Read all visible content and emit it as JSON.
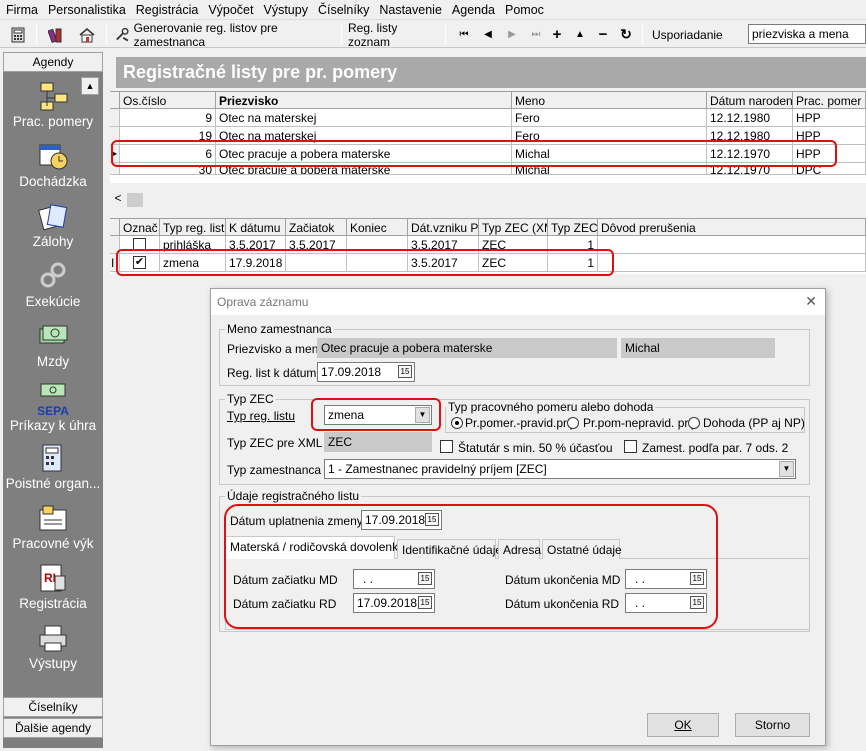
{
  "menu": [
    "Firma",
    "Personalistika",
    "Registrácia",
    "Výpočet",
    "Výstupy",
    "Číselníky",
    "Nastavenie",
    "Agenda",
    "Pomoc"
  ],
  "toolbar": {
    "gen_label": "Generovanie reg. listov pre  zamestnanca",
    "reg_list_label": "Reg. listy zoznam",
    "sort_label": "Usporiadanie",
    "sort_value": "priezviska a mena"
  },
  "sidebar": {
    "head": "Agendy",
    "items": [
      "Prac. pomery",
      "Dochádzka",
      "Zálohy",
      "Exekúcie",
      "Mzdy",
      "Príkazy k úhra",
      "Poistné organ...",
      "Pracovné výk",
      "Registrácia",
      "Výstupy"
    ],
    "sepa": "SEPA",
    "footer1": "Číselníky",
    "footer2": "Ďalšie agendy"
  },
  "main_title": "Registračné listy pre pr. pomery",
  "top_grid": {
    "headers": [
      "Os.číslo",
      "Priezvisko",
      "Meno",
      "Dátum narodenia",
      "Prac. pomer"
    ],
    "rows": [
      [
        "9",
        "Otec na materskej",
        "Fero",
        "12.12.1980",
        "HPP"
      ],
      [
        "19",
        "Otec na materskej",
        "Fero",
        "12.12.1980",
        "HPP"
      ],
      [
        "6",
        "Otec pracuje a pobera materske",
        "Michal",
        "12.12.1970",
        "HPP"
      ],
      [
        "30",
        "Otec pracuje a pobera materske",
        "Michal",
        "12.12.1970",
        "DPC"
      ]
    ]
  },
  "scroll_left": "<",
  "bottom_grid": {
    "headers": [
      "Označ",
      "Typ reg. listu",
      "K dátumu",
      "Začiatok",
      "Koniec",
      "Dát.vzniku PV",
      "Typ ZEC (XM",
      "Typ ZEC (",
      "Dôvod prerušenia"
    ],
    "rows": [
      [
        "",
        "prihláška",
        "3.5.2017",
        "3.5.2017",
        "",
        "3.5.2017",
        "ZEC",
        "1",
        ""
      ],
      [
        "",
        "zmena",
        "17.9.2018",
        "",
        "",
        "3.5.2017",
        "ZEC",
        "1",
        ""
      ]
    ],
    "marker": "I"
  },
  "dialog": {
    "title": "Oprava záznamu",
    "close": "✕",
    "g1_title": "Meno zamestnanca",
    "name_label": "Priezvisko a meno",
    "surname": "Otec pracuje a pobera materske",
    "firstname": "Michal",
    "reglist_label": "Reg. list k dátumu",
    "reglist_date": "17.09.2018",
    "g2_title": "Typ ZEC",
    "typ_reg_label": "Typ reg. listu",
    "typ_reg_value": "zmena",
    "pp_group_title": "Typ pracovného pomeru alebo dohoda",
    "radio1": "Pr.pomer.-pravid.príj.",
    "radio2": "Pr.pom-nepravid. príj.",
    "radio3": "Dohoda (PP aj NP)",
    "zec_xml_label": "Typ ZEC pre XML",
    "zec_xml_value": "ZEC",
    "statutar": "Štatutár s min. 50 % účasťou",
    "zamest": "Zamest. podľa par. 7 ods. 2",
    "typ_zam_label": "Typ zamestnanca",
    "typ_zam_value": "1 - Zamestnanec pravidelný príjem [ZEC]",
    "g3_title": "Údaje registračného listu",
    "uplat_label": "Dátum uplatnenia zmeny",
    "uplat_value": "17.09.2018",
    "tabs": [
      "Materská / rodičovská dovolenka",
      "Identifikačné údaje",
      "Adresa",
      "Ostatné údaje"
    ],
    "zac_md_label": "Dátum začiatku MD",
    "zac_md_value": ". .",
    "zac_rd_label": "Dátum začiatku RD",
    "zac_rd_value": "17.09.2018",
    "uk_md_label": "Dátum ukončenia MD",
    "uk_md_value": ". .",
    "uk_rd_label": "Dátum ukončenia RD",
    "uk_rd_value": ". .",
    "ok": "OK",
    "storno": "Storno",
    "cal": "15"
  }
}
